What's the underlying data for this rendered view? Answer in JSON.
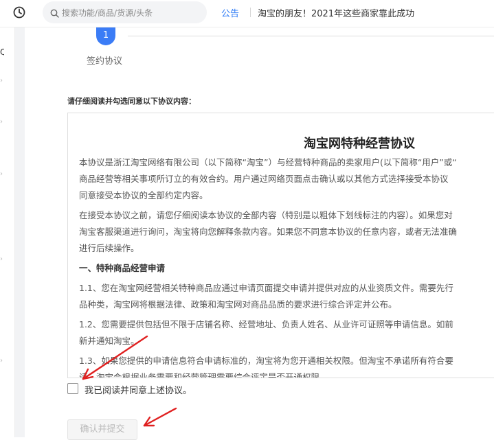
{
  "header": {
    "search_placeholder": "搜索功能/商品/货源/头条",
    "notice_tag": "公告",
    "notice_text": "淘宝的朋友！2021年这些商家靠此成功"
  },
  "leftnav": {
    "partial_char": "Q"
  },
  "steps": {
    "current_number": "1",
    "current_label": "签约协议"
  },
  "instruction": "请仔细阅读并勾选同意以下协议内容：",
  "agreement": {
    "title": "淘宝网特种经营协议",
    "lines": [
      "本协议是浙江淘宝网络有限公司（以下简称“淘宝”）与经营特种商品的卖家用户(以下简称“用户”或“",
      "商品经营等相关事项所订立的有效合约。用户通过网络页面点击确认或以其他方式选择接受本协议",
      "同意接受本协议的全部约定内容。",
      "在接受本协议之前，请您仔细阅读本协议的全部内容（特别是以粗体下划线标注的内容）。如果您对",
      "淘宝客服渠道进行询问，淘宝将向您解释条款内容。如果您不同意本协议的任意内容，或者无法准确",
      "进行后续操作。",
      "一、特种商品经营申请",
      "1.1、您在淘宝网经营相关特种商品应通过申请页面提交申请并提供对应的从业资质文件。需要先行",
      "品种类，淘宝网将根据法律、政策和淘宝网对商品品质的要求进行综合评定并公布。",
      "1.2、您需要提供包括但不限于店铺名称、经营地址、负责人姓名、从业许可证照等申请信息。如前",
      "新并通知淘宝。",
      "1.3、如果您提供的申请信息符合申请标准的，淘宝将为您开通相关权限。但淘宝不承诺所有符合要",
      "请，淘宝会根据业务需要和经营管理需要综合评定是否开通权限。"
    ]
  },
  "consent": {
    "label": "我已阅读并同意上述协议。",
    "checked": false
  },
  "submit": {
    "label": "确认并提交",
    "enabled": false
  },
  "colors": {
    "accent": "#3b7cf6",
    "link": "#2f7cf6",
    "annotation": "#e02020"
  }
}
